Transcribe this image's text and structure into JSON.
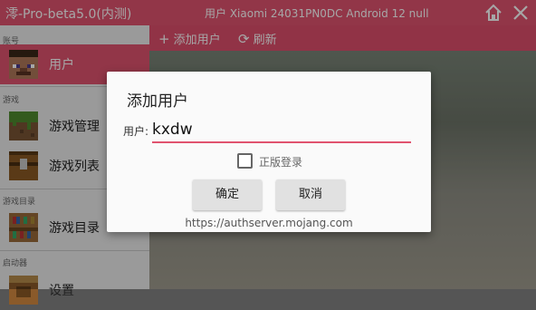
{
  "topbar": {
    "title": "澪-Pro-beta5.0(内测)",
    "device_info": "用户   Xiaomi 24031PN0DC Android 12 null",
    "home_icon": "home-icon",
    "close_icon": "close-icon"
  },
  "sidebar": {
    "sections": {
      "account": "账号",
      "game": "游戏",
      "game_dir": "游戏目录",
      "launcher": "启动器"
    },
    "items": [
      {
        "label": "用户",
        "icon": "steve-head-icon",
        "selected": true
      },
      {
        "label": "游戏管理",
        "icon": "grass-block-icon",
        "selected": false
      },
      {
        "label": "游戏列表",
        "icon": "chest-icon",
        "selected": false
      },
      {
        "label": "游戏目录",
        "icon": "bookshelf-icon",
        "selected": false
      },
      {
        "label": "设置",
        "icon": "crafting-table-icon",
        "selected": false
      }
    ]
  },
  "toolbar": {
    "add_user": "添加用户",
    "refresh": "刷新"
  },
  "dialog": {
    "title": "添加用户",
    "user_label": "用户:",
    "user_value": "kxdw",
    "premium_label": "正版登录",
    "premium_checked": false,
    "ok": "确定",
    "cancel": "取消",
    "auth_server": "https://authserver.mojang.com"
  },
  "colors": {
    "accent": "#e0536f",
    "sidebar_bg": "#ededed"
  }
}
